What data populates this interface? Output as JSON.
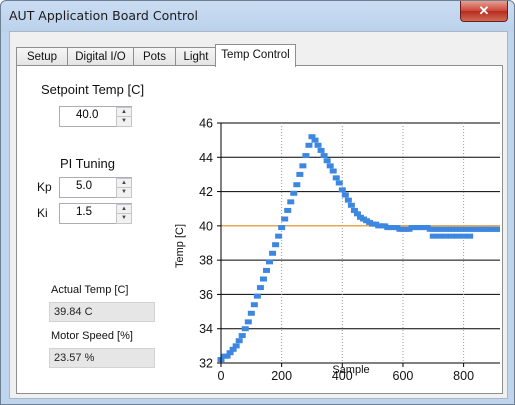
{
  "window": {
    "title": "AUT Application Board Control",
    "close_glyph": "✕"
  },
  "tabs": [
    {
      "label": "Setup"
    },
    {
      "label": "Digital I/O"
    },
    {
      "label": "Pots"
    },
    {
      "label": "Light"
    },
    {
      "label": "Temp Control",
      "active": true
    }
  ],
  "setpoint": {
    "label": "Setpoint Temp [C]",
    "value": "40.0"
  },
  "pi": {
    "label": "PI Tuning",
    "kp_label": "Kp",
    "kp_value": "5.0",
    "ki_label": "Ki",
    "ki_value": "1.5"
  },
  "actual_temp": {
    "label": "Actual Temp [C]",
    "value": "39.84 C"
  },
  "motor_speed": {
    "label": "Motor Speed [%]",
    "value": "23.57 %"
  },
  "colors": {
    "series": "#3d87e0",
    "setpoint_line": "#f0a23a"
  },
  "chart_data": {
    "type": "scatter",
    "xlabel": "Sample",
    "ylabel": "Temp [C]",
    "xlim": [
      0,
      920
    ],
    "ylim": [
      32,
      46
    ],
    "xticks": [
      0,
      200,
      400,
      600,
      800
    ],
    "yticks": [
      32,
      34,
      36,
      38,
      40,
      42,
      44,
      46
    ],
    "grid": true,
    "setpoint": 40,
    "series": [
      {
        "x": [
          0,
          10,
          20,
          30,
          40,
          50,
          60,
          70,
          80,
          90,
          100,
          110,
          120,
          130,
          140,
          150,
          160,
          170,
          180,
          190,
          200,
          210,
          220,
          230,
          240,
          250,
          260,
          270,
          280,
          290,
          300,
          310,
          320,
          330,
          340,
          350,
          360,
          370,
          380,
          390,
          400,
          410,
          420,
          430,
          440,
          450,
          460,
          470,
          480,
          490,
          500,
          510,
          520,
          530,
          540,
          550,
          560,
          570,
          580,
          590,
          600,
          610,
          620,
          630,
          640,
          650,
          660,
          670,
          680,
          690,
          700,
          710,
          720,
          730,
          740,
          750,
          760,
          770,
          780,
          790,
          800,
          810,
          820,
          830,
          840,
          850,
          860,
          870,
          880,
          890,
          900,
          910,
          920,
          700,
          720,
          740,
          760,
          780,
          800,
          820
        ],
        "y": [
          32.2,
          32.4,
          32.4,
          32.6,
          32.8,
          33.0,
          33.3,
          33.6,
          34.0,
          34.4,
          34.9,
          35.4,
          35.9,
          36.4,
          36.9,
          37.4,
          37.9,
          38.4,
          38.9,
          39.4,
          39.9,
          40.4,
          40.9,
          41.4,
          41.9,
          42.4,
          43.0,
          43.5,
          44.1,
          44.7,
          45.2,
          45.0,
          44.7,
          44.4,
          44.1,
          43.8,
          43.5,
          43.2,
          42.8,
          42.5,
          42.1,
          41.8,
          41.5,
          41.2,
          40.9,
          40.7,
          40.5,
          40.4,
          40.3,
          40.2,
          40.1,
          40.1,
          40.0,
          40.0,
          40.0,
          39.9,
          39.9,
          39.9,
          39.9,
          39.8,
          39.8,
          39.8,
          39.8,
          39.9,
          39.9,
          39.9,
          39.9,
          39.9,
          39.9,
          39.8,
          39.8,
          39.8,
          39.8,
          39.8,
          39.8,
          39.8,
          39.8,
          39.8,
          39.8,
          39.8,
          39.8,
          39.8,
          39.8,
          39.8,
          39.8,
          39.8,
          39.8,
          39.8,
          39.8,
          39.8,
          39.8,
          39.8,
          39.8,
          39.4,
          39.4,
          39.4,
          39.4,
          39.4,
          39.4,
          39.4
        ]
      }
    ]
  }
}
